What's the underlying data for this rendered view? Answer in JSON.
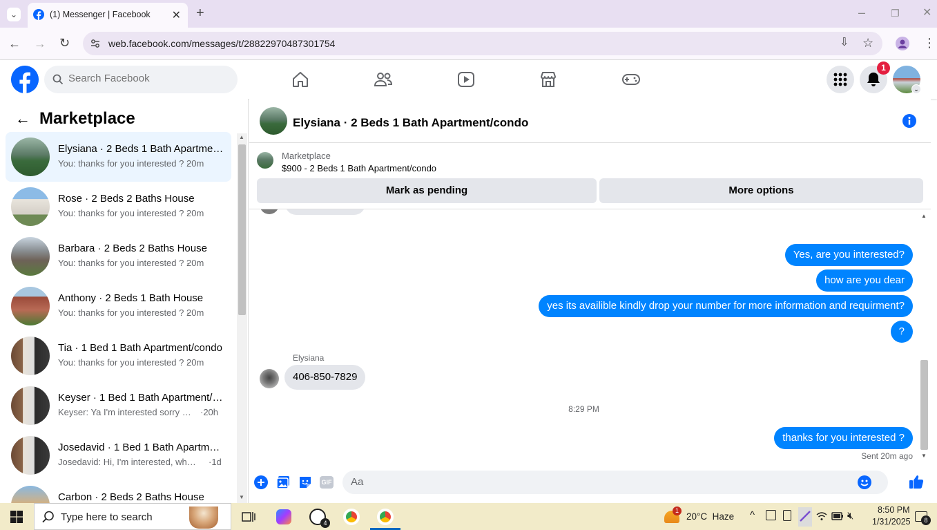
{
  "browser": {
    "tab_title": "(1) Messenger | Facebook",
    "url": "web.facebook.com/messages/t/28822970487301754"
  },
  "fb_header": {
    "search_placeholder": "Search Facebook",
    "notification_count": "1"
  },
  "sidebar": {
    "title": "Marketplace",
    "conversations": [
      {
        "name": "Elysiana · 2 Beds 1 Bath Apartment/condo",
        "snippet": "You: thanks for you interested ? ·",
        "time": "20m"
      },
      {
        "name": "Rose · 2 Beds 2 Baths House",
        "snippet": "You: thanks for you interested ? ·",
        "time": "20m"
      },
      {
        "name": "Barbara · 2 Beds 2 Baths House",
        "snippet": "You: thanks for you interested ? ·",
        "time": "20m"
      },
      {
        "name": "Anthony · 2 Beds 1 Bath House",
        "snippet": "You: thanks for you interested ? ·",
        "time": "20m"
      },
      {
        "name": "Tia · 1 Bed 1 Bath Apartment/condo",
        "snippet": "You: thanks for you interested ? ·",
        "time": "20m"
      },
      {
        "name": "Keyser · 1 Bed 1 Bath Apartment/condo",
        "snippet": "Keyser: Ya I'm interested sorry I d...",
        "time": "·20h"
      },
      {
        "name": "Josedavid · 1 Bed 1 Bath Apartment/condo",
        "snippet": "Josedavid: Hi, I'm interested, when ...",
        "time": "·1d"
      },
      {
        "name": "Carbon · 2 Beds 2 Baths House",
        "snippet": "",
        "time": ""
      }
    ]
  },
  "chat": {
    "title": "Elysiana · 2 Beds 1 Bath Apartment/condo",
    "listing_label": "Marketplace",
    "listing_desc": "$900 - 2 Beds 1 Bath Apartment/condo",
    "mark_pending": "Mark as pending",
    "more_options": "More options",
    "outgoing": [
      "Yes, are you interested?",
      "how are you dear",
      "yes its availible kindly drop your number for more information and requirment?",
      "?"
    ],
    "sender_name": "Elysiana",
    "incoming": "406-850-7829",
    "divider_time": "8:29 PM",
    "last_outgoing": "thanks for you interested ?",
    "sent_status": "Sent 20m ago",
    "composer_placeholder": "Aa"
  },
  "taskbar": {
    "search_placeholder": "Type here to search",
    "weather": "20°C  Haze",
    "time": "8:50 PM",
    "date": "1/31/2025",
    "whatsapp_badge": "4",
    "notif_count": "8",
    "weather_badge": "1"
  }
}
